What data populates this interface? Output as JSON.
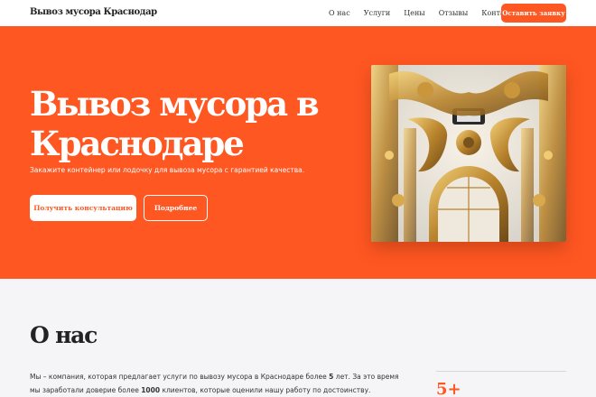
{
  "header": {
    "brand": "Вывоз мусора Краснодар",
    "nav": [
      "О нас",
      "Услуги",
      "Цены",
      "Отзывы",
      "Контакты"
    ],
    "cta_label": "Оставить заявку"
  },
  "hero": {
    "title": "Вывоз мусора в Краснодаре",
    "subtitle": "Закажите контейнер или лодочку для вывоза мусора с гарантией качества.",
    "primary_button": "Получить консультацию",
    "secondary_button": "Подробнее"
  },
  "about": {
    "title": "О нас",
    "text_part1": "Мы – компания, которая предлагает услуги по вывозу мусора в Краснодаре более ",
    "years_value": "5",
    "text_part2": " лет. За это время мы заработали доверие более ",
    "clients_value": "1000",
    "text_part3": " клиентов, которые оценили нашу работу по достоинству.",
    "stat_value": "5+"
  },
  "colors": {
    "accent": "#ff5722",
    "background": "#f5f5f7",
    "header_bg": "#ffffff",
    "text": "#2b2b2b"
  }
}
